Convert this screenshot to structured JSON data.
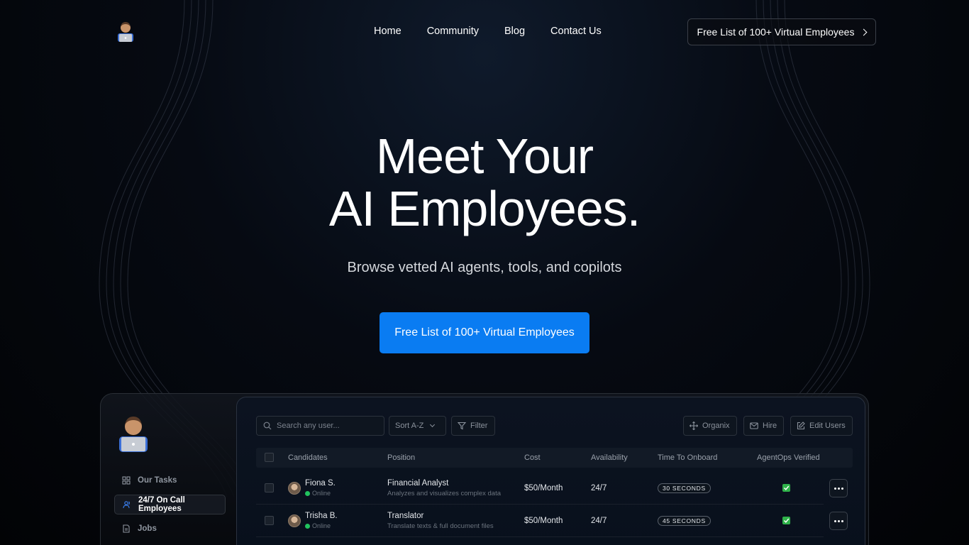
{
  "header": {
    "logo_icon": "person-with-laptop-emoji",
    "nav": [
      "Home",
      "Community",
      "Blog",
      "Contact Us"
    ],
    "cta_label": "Free List of 100+ Virtual Employees"
  },
  "hero": {
    "title_line1": "Meet Your",
    "title_line2": "AI Employees.",
    "subtitle": "Browse vetted AI agents, tools, and copilots",
    "cta_label": "Free List of 100+ Virtual Employees",
    "cta_color": "#0a7cf2"
  },
  "dashboard": {
    "avatar_icon": "person-with-laptop-emoji",
    "sidebar": [
      {
        "label": "Our Tasks",
        "icon": "grid-icon",
        "active": false
      },
      {
        "label": "24/7 On Call Employees",
        "icon": "users-icon",
        "active": true
      },
      {
        "label": "Jobs",
        "icon": "document-icon",
        "active": false
      }
    ],
    "toolbar": {
      "search_placeholder": "Search any user...",
      "sort_label": "Sort A-Z",
      "filter_label": "Filter",
      "organix_label": "Organix",
      "hire_label": "Hire",
      "edit_users_label": "Edit Users"
    },
    "table": {
      "columns": [
        "Candidates",
        "Position",
        "Cost",
        "Availability",
        "Time To Onboard",
        "AgentOps Verified"
      ],
      "rows": [
        {
          "name": "Fiona S.",
          "status": "Online",
          "position": "Financial Analyst",
          "description": "Analyzes and visualizes complex data",
          "cost": "$50/Month",
          "availability": "24/7",
          "onboard": "30 SECONDS",
          "verified": true
        },
        {
          "name": "Trisha B.",
          "status": "Online",
          "position": "Translator",
          "description": "Translate texts & full document files",
          "cost": "$50/Month",
          "availability": "24/7",
          "onboard": "45 SECONDS",
          "verified": true
        }
      ]
    },
    "status_color": "#21c25e",
    "verified_color": "#2fb24a"
  }
}
